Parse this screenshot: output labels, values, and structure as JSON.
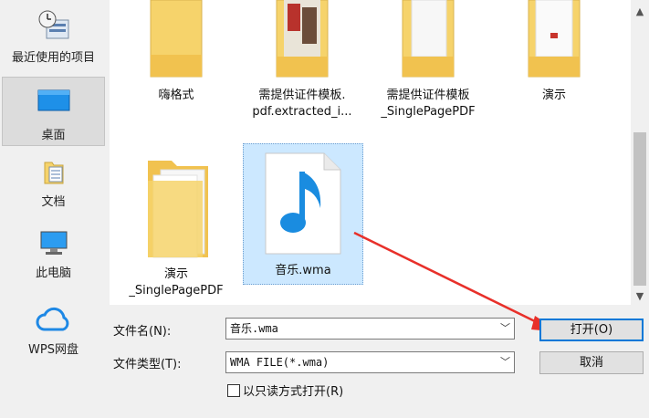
{
  "sidebar": {
    "items": [
      {
        "label": "最近使用的项目",
        "icon": "recent-places-icon"
      },
      {
        "label": "桌面",
        "icon": "desktop-icon",
        "selected": true
      },
      {
        "label": "文档",
        "icon": "documents-icon"
      },
      {
        "label": "此电脑",
        "icon": "computer-icon"
      },
      {
        "label": "WPS网盘",
        "icon": "cloud-icon"
      }
    ]
  },
  "files": [
    {
      "name_line1": "嗨格式",
      "name_line2": "",
      "icon": "folder-icon"
    },
    {
      "name_line1": "需提供证件模板.",
      "name_line2": "pdf.extracted_i...",
      "icon": "folder-icon"
    },
    {
      "name_line1": "需提供证件模板",
      "name_line2": "_SinglePagePDF",
      "icon": "folder-icon"
    },
    {
      "name_line1": "演示",
      "name_line2": "",
      "icon": "folder-icon"
    },
    {
      "name_line1": "演示",
      "name_line2": "_SinglePagePDF",
      "icon": "folder-icon"
    },
    {
      "name_line1": "音乐.wma",
      "name_line2": "",
      "icon": "music-file-icon",
      "selected": true
    }
  ],
  "form": {
    "filename_label": "文件名(N):",
    "filename_value": "音乐.wma",
    "filetype_label": "文件类型(T):",
    "filetype_value": "WMA FILE(*.wma)",
    "readonly_label": "以只读方式打开(R)",
    "open_button": "打开(O)",
    "cancel_button": "取消"
  },
  "colors": {
    "accent": "#0078d7",
    "selection": "#cce8ff",
    "folder": "#f6d36b",
    "arrow": "#e8302a",
    "music_note": "#1a8ce0"
  }
}
